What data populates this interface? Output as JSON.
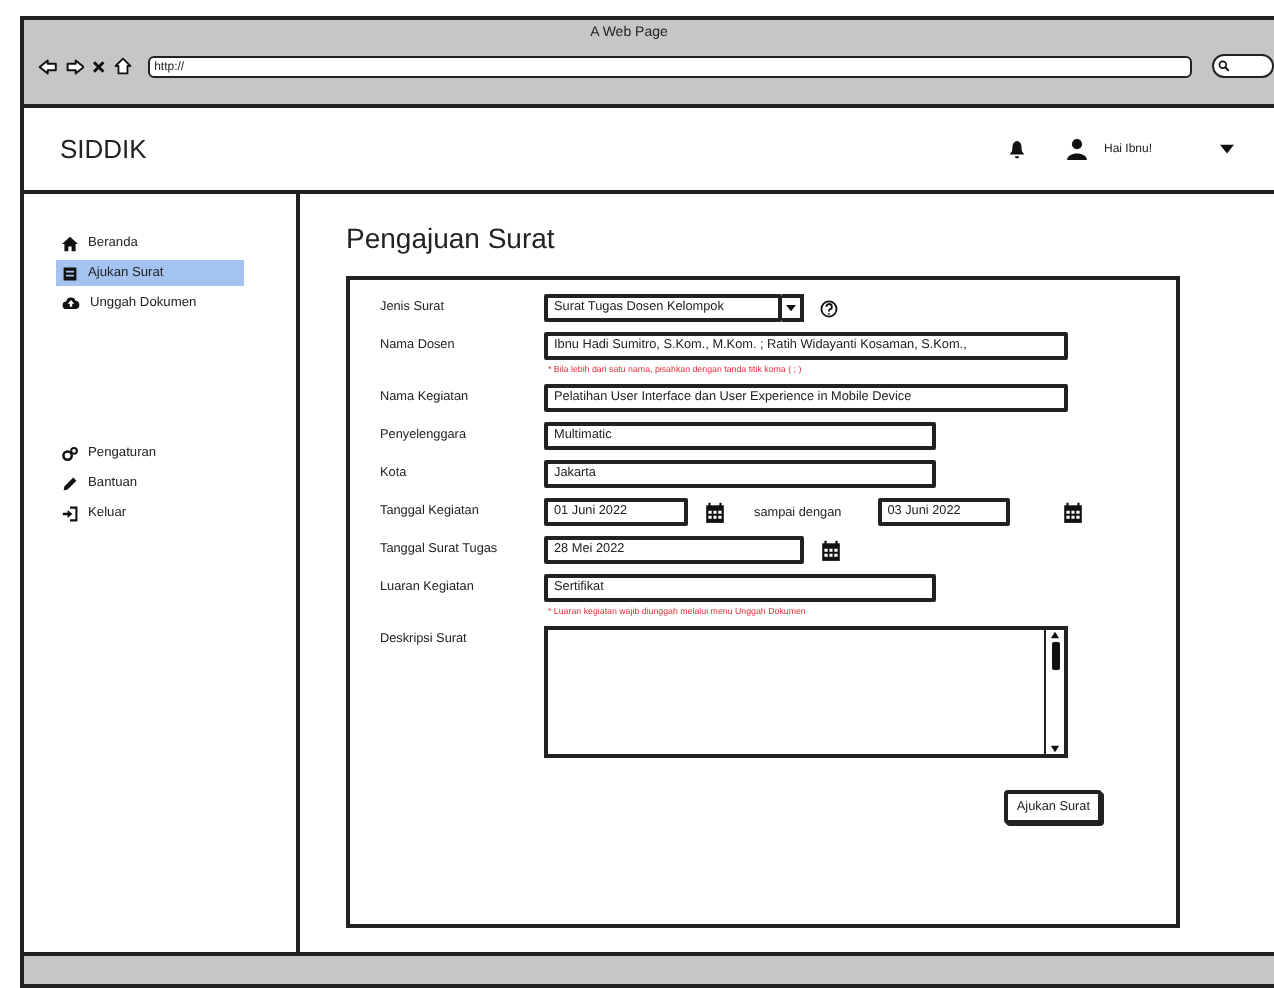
{
  "browser": {
    "title": "A Web Page",
    "url": "http://"
  },
  "header": {
    "brand": "SIDDIK",
    "greeting": "Hai Ibnu!"
  },
  "sidebar": {
    "groups": [
      {
        "items": [
          {
            "label": "Beranda",
            "selected": false
          },
          {
            "label": "Ajukan Surat",
            "selected": true
          },
          {
            "label": "Unggah Dokumen",
            "selected": false
          }
        ]
      },
      {
        "items": [
          {
            "label": "Pengaturan",
            "selected": false
          },
          {
            "label": "Bantuan",
            "selected": false
          },
          {
            "label": "Keluar",
            "selected": false
          }
        ]
      }
    ]
  },
  "form": {
    "title": "Pengajuan Surat",
    "fields": [
      {
        "kind": "select",
        "label": "Jenis Surat",
        "value": "Surat Tugas Dosen Kelompok"
      },
      {
        "kind": "text",
        "label": "Nama Dosen",
        "value": "Ibnu Hadi Sumitro, S.Kom., M.Kom. ; Ratih Widayanti Kosaman, S.Kom.,",
        "hint": "* Bila lebih dari satu nama, pisahkan dengan tanda titik koma ( ; )"
      },
      {
        "kind": "text",
        "label": "Nama Kegiatan",
        "value": "Pelatihan User Interface dan User Experience in Mobile Device"
      },
      {
        "kind": "text",
        "label": "Penyelenggara",
        "value": "Multimatic"
      },
      {
        "kind": "text",
        "label": "Kota",
        "value": "Jakarta"
      },
      {
        "kind": "date-range",
        "label": "Tanggal Kegiatan",
        "value": "01 Juni 2022",
        "connector": "sampai dengan",
        "value_end": "03 Juni 2022"
      },
      {
        "kind": "date",
        "label": "Tanggal Surat Tugas",
        "value": "28 Mei 2022"
      },
      {
        "kind": "text",
        "label": "Luaran Kegiatan",
        "value": "Sertifikat",
        "hint": "* Luaran kegiatan wajib diunggah melalui menu Unggah Dokumen"
      },
      {
        "kind": "textarea",
        "label": "Deskripsi Surat"
      }
    ],
    "submit": "Ajukan Surat"
  }
}
